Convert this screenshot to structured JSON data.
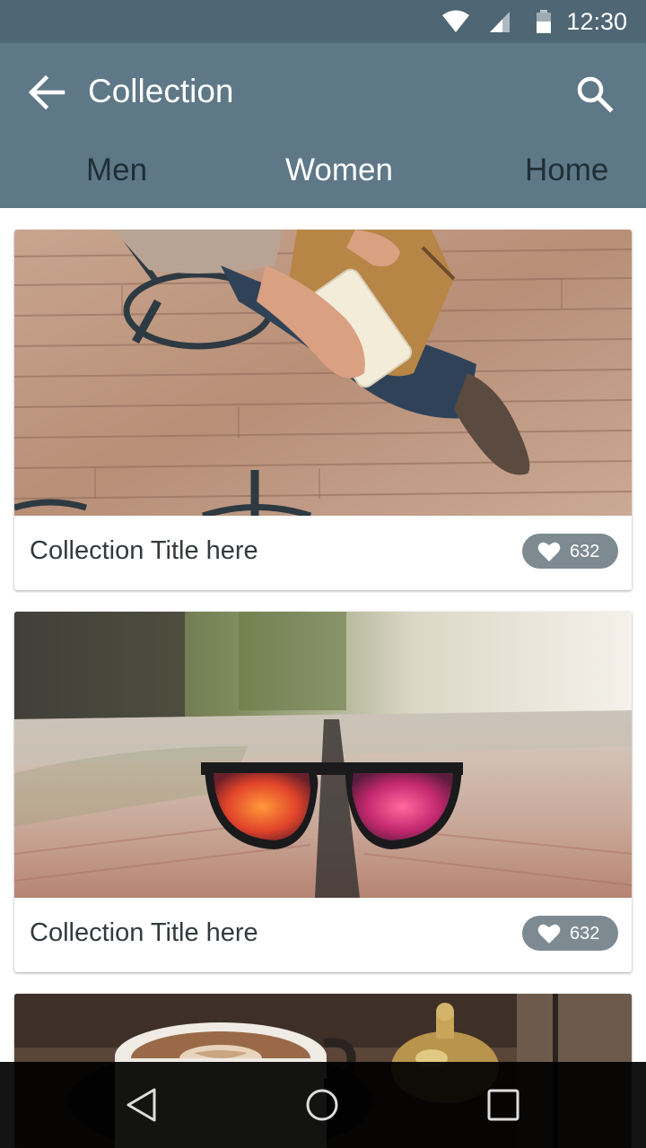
{
  "status_bar": {
    "time": "12:30",
    "icons": [
      "wifi-icon",
      "cell-signal-icon",
      "battery-icon"
    ]
  },
  "app_bar": {
    "title": "Collection",
    "back_icon": "arrow-back-icon",
    "search_icon": "search-icon",
    "background": "#5e7887"
  },
  "tabs": [
    {
      "label": "Men",
      "active": false
    },
    {
      "label": "Women",
      "active": true
    },
    {
      "label": "Home",
      "active": false
    }
  ],
  "cards": [
    {
      "title": "Collection Title here",
      "likes": "632",
      "image": "woman-holding-wallet-photo"
    },
    {
      "title": "Collection Title here",
      "likes": "632",
      "image": "sunglasses-on-bench-photo"
    },
    {
      "image": "coffee-cup-photo"
    }
  ],
  "nav_bar": {
    "buttons": [
      "back-triangle-icon",
      "home-circle-icon",
      "recents-square-icon"
    ]
  },
  "colors": {
    "status_bar": "#4f6674",
    "app_bar": "#5e7887",
    "tab_inactive": "#1f2f38",
    "tab_active": "#ffffff",
    "like_chip": "#7d8a91"
  }
}
